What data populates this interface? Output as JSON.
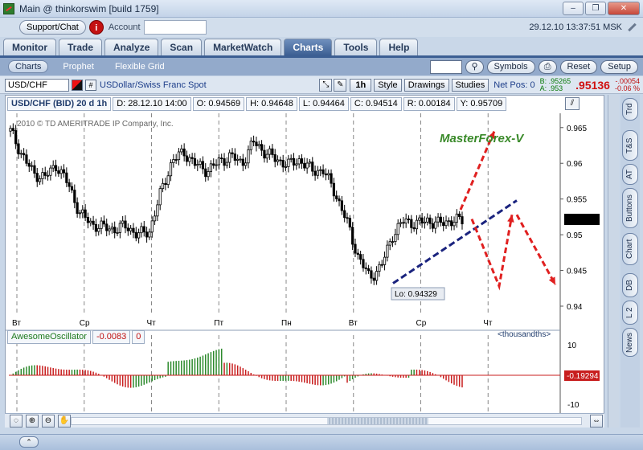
{
  "window": {
    "title": "Main @ thinkorswim [build 1759]",
    "minimize": "–",
    "restore": "❐",
    "close": "✕"
  },
  "toolbar": {
    "support_label": "Support/Chat",
    "info_label": "i",
    "account_label": "Account",
    "clock": "29.12.10 13:37:51 MSK"
  },
  "tabs": [
    {
      "label": "Monitor",
      "active": false
    },
    {
      "label": "Trade",
      "active": false
    },
    {
      "label": "Analyze",
      "active": false
    },
    {
      "label": "Scan",
      "active": false
    },
    {
      "label": "MarketWatch",
      "active": false
    },
    {
      "label": "Charts",
      "active": true
    },
    {
      "label": "Tools",
      "active": false
    },
    {
      "label": "Help",
      "active": false
    }
  ],
  "subtabs": [
    {
      "label": "Charts",
      "active": true
    },
    {
      "label": "Prophet",
      "active": false
    },
    {
      "label": "Flexible Grid",
      "active": false
    }
  ],
  "subbar_buttons": {
    "symbols": "Symbols",
    "reset": "Reset",
    "setup": "Setup"
  },
  "chart_header": {
    "symbol": "USD/CHF",
    "hash": "#",
    "description": "USDollar/Swiss Franc Spot",
    "timeframe": "1h",
    "style": "Style",
    "drawings": "Drawings",
    "studies": "Studies",
    "net_pos": "Net Pos: 0",
    "bid": "B: .95265",
    "ask": "A: .953",
    "last": ".95136",
    "change": "-.00054",
    "change_pct": "-0.06 %"
  },
  "info_strip": [
    {
      "label": "USD/CHF (BID) 20 d 1h",
      "bold": true
    },
    {
      "label": "D: 28.12.10 14:00"
    },
    {
      "label": "O: 0.94569"
    },
    {
      "label": "H: 0.94648"
    },
    {
      "label": "L: 0.94464"
    },
    {
      "label": "C: 0.94514"
    },
    {
      "label": "R: 0.00184"
    },
    {
      "label": "Y: 0.95709"
    }
  ],
  "copyright": "2010 © TD AMERITRADE IP Company, Inc.",
  "annotation": "MasterForex-V",
  "low_label": "Lo: 0.94329",
  "right_rail": [
    "Trd",
    "T&S",
    "AT",
    "Buttons",
    "Chart",
    "DB",
    "L 2",
    "News"
  ],
  "oscillator": {
    "name": "AwesomeOscillator",
    "value": "-0.0083",
    "zero": "0",
    "units": "<thousandths>",
    "current": "-0.19294",
    "ticks": [
      "10",
      "-10"
    ]
  },
  "colors": {
    "up": "#2d8a2d",
    "down": "#c81e1e",
    "candle": "#000000",
    "trendline": "#1a237e",
    "arrow": "#e02020",
    "annotation": "#3a8a2a"
  },
  "chart_data": {
    "type": "line",
    "series": [
      {
        "values": [
          0.9645,
          0.9612,
          0.9585,
          0.9581,
          0.9598,
          0.957,
          0.953,
          0.9515,
          0.951,
          0.9508,
          0.9512,
          0.95,
          0.9505,
          0.956,
          0.9605,
          0.9615,
          0.9598,
          0.959,
          0.9602,
          0.961,
          0.96,
          0.963,
          0.9615,
          0.9605,
          0.9598,
          0.9605,
          0.959,
          0.959,
          0.956,
          0.952,
          0.947,
          0.944,
          0.9455,
          0.95,
          0.952,
          0.9515,
          0.952,
          0.9515,
          0.952,
          0.952
        ]
      }
    ],
    "y_ticks": [
      "0.965",
      "0.96",
      "0.955",
      "0.95",
      "0.945",
      "0.94"
    ],
    "ylim": [
      0.94,
      0.967
    ],
    "x_ticks": [
      "Вт",
      "Ср",
      "Чт",
      "Пт",
      "Пн",
      "Вт",
      "Ср",
      "Чт"
    ],
    "grid": true,
    "current_price": "0.95136"
  }
}
